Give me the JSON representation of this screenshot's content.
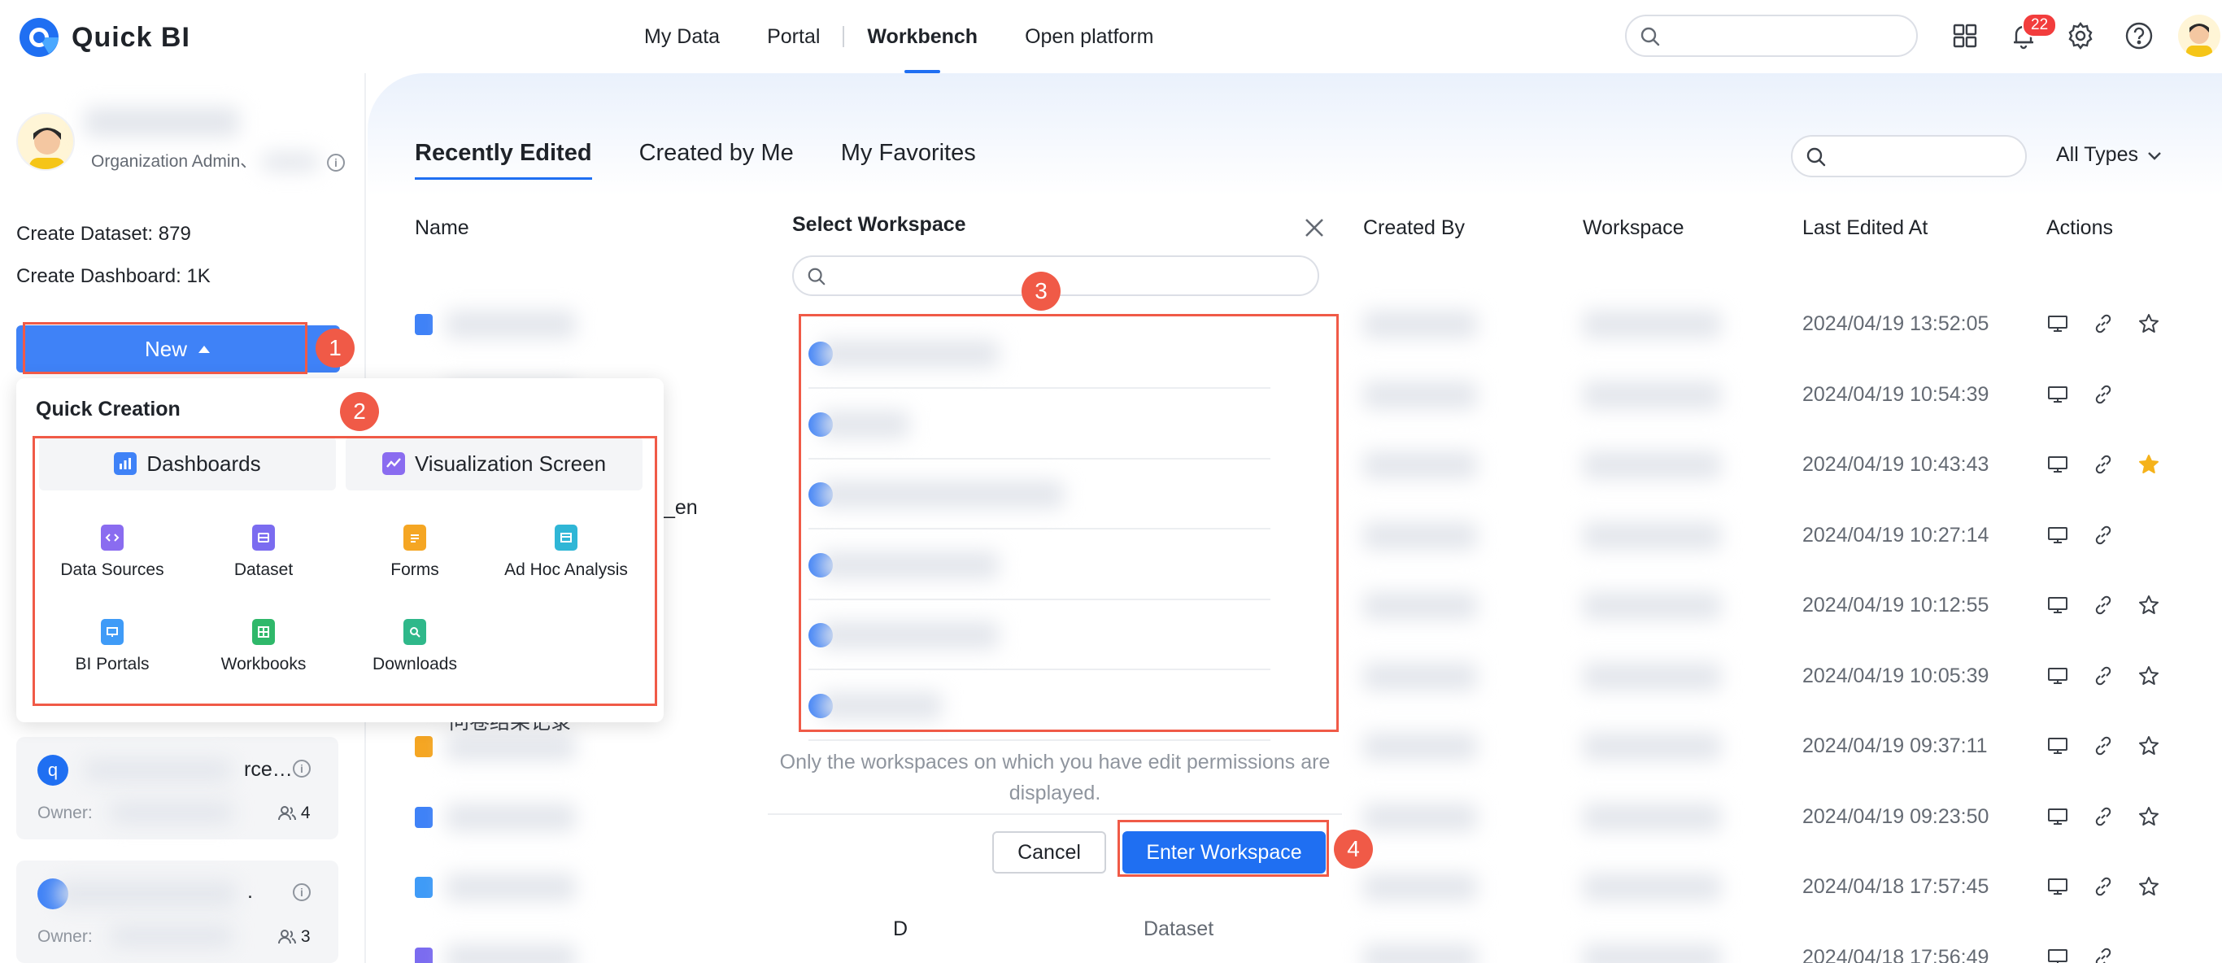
{
  "app": {
    "name": "Quick BI"
  },
  "nav": {
    "items": [
      "My Data",
      "Portal",
      "Workbench",
      "Open platform"
    ],
    "active": "Workbench"
  },
  "notifications": {
    "count": "22"
  },
  "sidebar": {
    "role": "Organization Admin、",
    "stats": [
      {
        "label": "Create Dataset:",
        "value": "879"
      },
      {
        "label": "Create Dashboard:",
        "value": "1K"
      }
    ],
    "new_button": "New",
    "workspaces": [
      {
        "avatar_letter": "q",
        "name_suffix": "rce…",
        "owner_label": "Owner:",
        "members": "4"
      },
      {
        "name_suffix": ".",
        "owner_label": "Owner:",
        "members": "3"
      }
    ]
  },
  "quick_creation": {
    "title": "Quick Creation",
    "primary": [
      "Dashboards",
      "Visualization Screen"
    ],
    "items": [
      "Data Sources",
      "Dataset",
      "Forms",
      "Ad Hoc Analysis",
      "BI Portals",
      "Workbooks",
      "Downloads"
    ]
  },
  "steps": [
    "1",
    "2",
    "3",
    "4"
  ],
  "main": {
    "tabs": [
      "Recently Edited",
      "Created by Me",
      "My Favorites"
    ],
    "active_tab": "Recently Edited",
    "filter": "All Types",
    "columns": [
      "Name",
      "Created By",
      "Workspace",
      "Last Edited At",
      "Actions"
    ],
    "partial_texts": {
      "row4_name_tail": "_en",
      "row7_name": "问卷结果记录",
      "row10_type": "Dataset",
      "row10_tail": "D"
    },
    "rows": [
      {
        "date": "2024/04/19 13:52:05",
        "icon": "dashboard-icon",
        "star": "empty"
      },
      {
        "date": "2024/04/19 10:54:39",
        "icon": "dataset-icon",
        "star": "none"
      },
      {
        "date": "2024/04/19 10:43:43",
        "icon": "",
        "star": "filled"
      },
      {
        "date": "2024/04/19 10:27:14",
        "icon": "",
        "star": "none"
      },
      {
        "date": "2024/04/19 10:12:55",
        "icon": "",
        "star": "empty"
      },
      {
        "date": "2024/04/19 10:05:39",
        "icon": "",
        "star": "empty"
      },
      {
        "date": "2024/04/19 09:37:11",
        "icon": "form-icon",
        "star": "empty"
      },
      {
        "date": "2024/04/19 09:23:50",
        "icon": "dashboard-icon",
        "star": "empty"
      },
      {
        "date": "2024/04/18 17:57:45",
        "icon": "portal-icon",
        "star": "empty"
      },
      {
        "date": "2024/04/18 17:56:49",
        "icon": "dataset-icon",
        "star": "none"
      }
    ]
  },
  "modal": {
    "title": "Select Workspace",
    "note": "Only the workspaces on which you have edit permissions are displayed.",
    "cancel": "Cancel",
    "confirm": "Enter Workspace"
  },
  "colors": {
    "primary": "#1f6ff2",
    "callout": "#f05a47",
    "star": "#f5b21b"
  }
}
